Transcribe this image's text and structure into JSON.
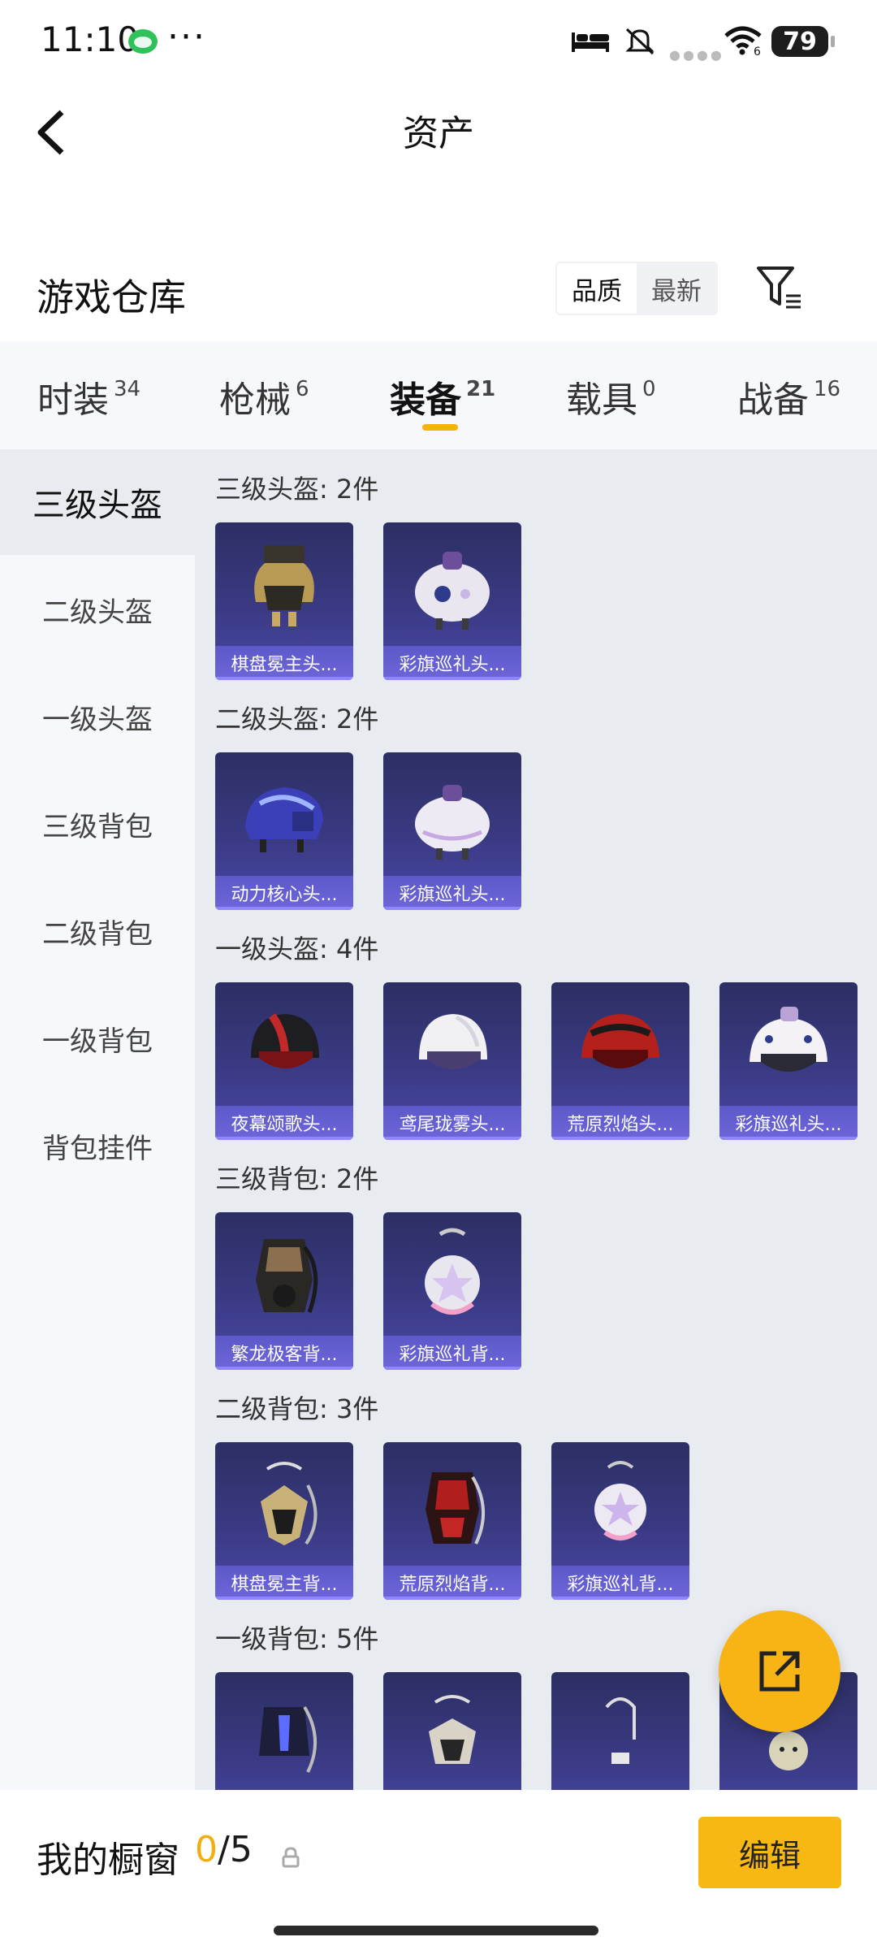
{
  "status_bar": {
    "time": "11:10",
    "dots": "···",
    "battery": "79"
  },
  "header": {
    "title": "资产"
  },
  "warehouse": {
    "title": "游戏仓库",
    "sort_options": [
      "品质",
      "最新"
    ]
  },
  "tabs": [
    {
      "label": "时装",
      "count": "34"
    },
    {
      "label": "枪械",
      "count": "6"
    },
    {
      "label": "装备",
      "count": "21"
    },
    {
      "label": "载具",
      "count": "0"
    },
    {
      "label": "战备",
      "count": "16"
    }
  ],
  "sidebar": [
    "三级头盔",
    "二级头盔",
    "一级头盔",
    "三级背包",
    "二级背包",
    "一级背包",
    "背包挂件"
  ],
  "sections": [
    {
      "title": "三级头盔: 2件",
      "items": [
        "棋盘冕主头...",
        "彩旗巡礼头..."
      ]
    },
    {
      "title": "二级头盔: 2件",
      "items": [
        "动力核心头...",
        "彩旗巡礼头..."
      ]
    },
    {
      "title": "一级头盔: 4件",
      "items": [
        "夜幕颂歌头...",
        "鸢尾珑雾头...",
        "荒原烈焰头...",
        "彩旗巡礼头..."
      ]
    },
    {
      "title": "三级背包: 2件",
      "items": [
        "繁龙极客背...",
        "彩旗巡礼背..."
      ]
    },
    {
      "title": "二级背包: 3件",
      "items": [
        "棋盘冕主背...",
        "荒原烈焰背...",
        "彩旗巡礼背..."
      ]
    },
    {
      "title": "一级背包: 5件",
      "items": [
        "",
        "",
        "",
        ""
      ]
    }
  ],
  "bottom": {
    "showcase_label": "我的橱窗",
    "count_current": "0",
    "count_total": "/5",
    "edit_label": "编辑"
  }
}
